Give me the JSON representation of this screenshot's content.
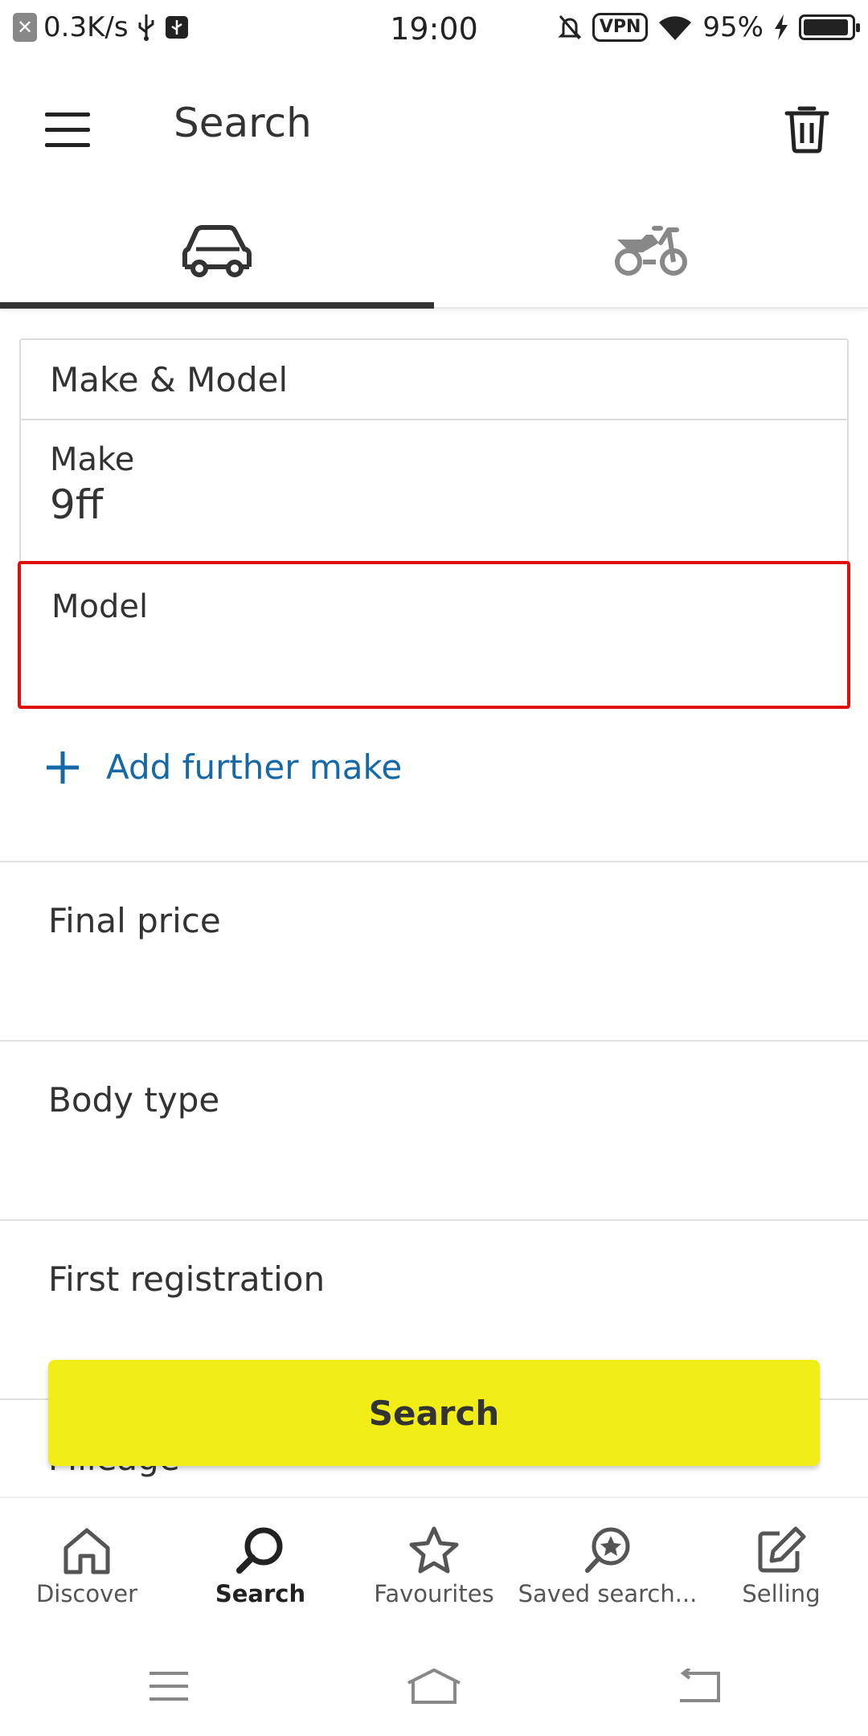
{
  "status_bar": {
    "speed": "0.3K/s",
    "time": "19:00",
    "vpn": "VPN",
    "battery": "95%",
    "battery_level": 0.95
  },
  "app_bar": {
    "title": "Search",
    "menu_icon": "hamburger-menu-icon",
    "action_icon": "trash-icon"
  },
  "tabs": [
    {
      "icon": "car-icon",
      "selected": true
    },
    {
      "icon": "motorbike-icon",
      "selected": false
    }
  ],
  "make_model": {
    "header": "Make & Model",
    "make_label": "Make",
    "make_value": "9ff",
    "model_label": "Model",
    "add_make": "Add further make"
  },
  "filters": [
    {
      "label": "Final price"
    },
    {
      "label": "Body type"
    },
    {
      "label": "First registration"
    },
    {
      "label": "Mileage"
    }
  ],
  "search_button": "Search",
  "bottom_nav": [
    {
      "label": "Discover",
      "icon": "home-icon",
      "active": false
    },
    {
      "label": "Search",
      "icon": "search-icon",
      "active": true
    },
    {
      "label": "Favourites",
      "icon": "star-icon",
      "active": false
    },
    {
      "label": "Saved search...",
      "icon": "saved-search-icon",
      "active": false
    },
    {
      "label": "Selling",
      "icon": "edit-icon",
      "active": false
    }
  ],
  "colors": {
    "accent_yellow": "#f1ee17",
    "link_blue": "#1569a9",
    "highlight_red": "#e10d0d",
    "text_dark": "#333333"
  }
}
